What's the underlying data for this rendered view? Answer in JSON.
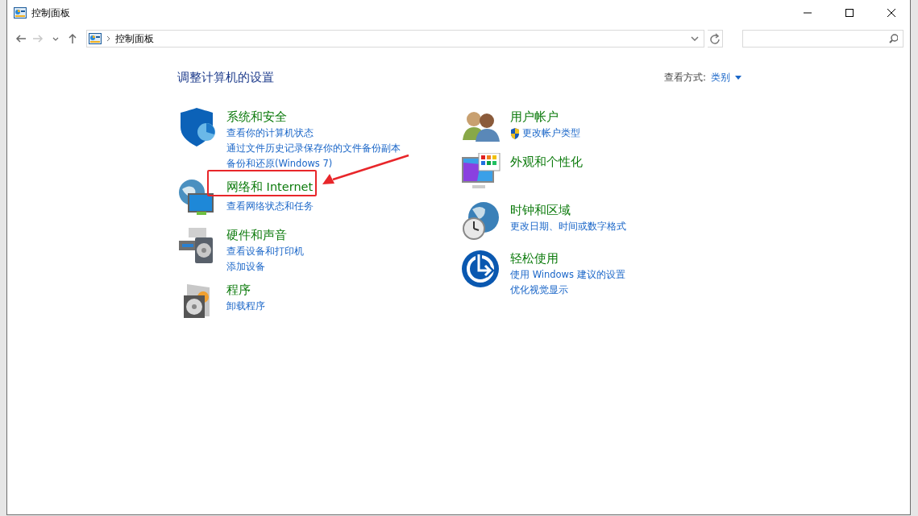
{
  "window": {
    "title": "控制面板"
  },
  "navigation": [
    {
      "kind": "back",
      "disabled": false
    },
    {
      "kind": "forward",
      "disabled": true
    },
    {
      "kind": "recent",
      "disabled": false
    },
    {
      "kind": "up",
      "disabled": false
    }
  ],
  "address_bar": {
    "path": "控制面板"
  },
  "header": {
    "title": "调整计算机的设置",
    "view_by_label": "查看方式:",
    "view_by_value": "类别"
  },
  "columns": [
    [
      {
        "kind": "security",
        "title": "系统和安全",
        "highlighted": false,
        "links": [
          {
            "text": "查看你的计算机状态",
            "shield": false
          },
          {
            "text": "通过文件历史记录保存你的文件备份副本",
            "shield": false
          },
          {
            "text": "备份和还原(Windows 7)",
            "shield": false
          }
        ]
      },
      {
        "kind": "network",
        "title": "网络和 Internet",
        "highlighted": true,
        "links": [
          {
            "text": "查看网络状态和任务",
            "shield": false
          }
        ]
      },
      {
        "kind": "hardware",
        "title": "硬件和声音",
        "highlighted": false,
        "links": [
          {
            "text": "查看设备和打印机",
            "shield": false
          },
          {
            "text": "添加设备",
            "shield": false
          }
        ]
      },
      {
        "kind": "programs",
        "title": "程序",
        "highlighted": false,
        "links": [
          {
            "text": "卸载程序",
            "shield": false
          }
        ]
      }
    ],
    [
      {
        "kind": "users",
        "title": "用户帐户",
        "highlighted": false,
        "links": [
          {
            "text": "更改帐户类型",
            "shield": true
          }
        ]
      },
      {
        "kind": "appearance",
        "title": "外观和个性化",
        "highlighted": false
      },
      {
        "kind": "clock",
        "title": "时钟和区域",
        "highlighted": false,
        "links": [
          {
            "text": "更改日期、时间或数字格式",
            "shield": false
          }
        ]
      },
      {
        "kind": "access",
        "title": "轻松使用",
        "highlighted": false,
        "links": [
          {
            "text": "使用 Windows 建议的设置",
            "shield": false
          },
          {
            "text": "优化视觉显示",
            "shield": false
          }
        ]
      }
    ]
  ]
}
